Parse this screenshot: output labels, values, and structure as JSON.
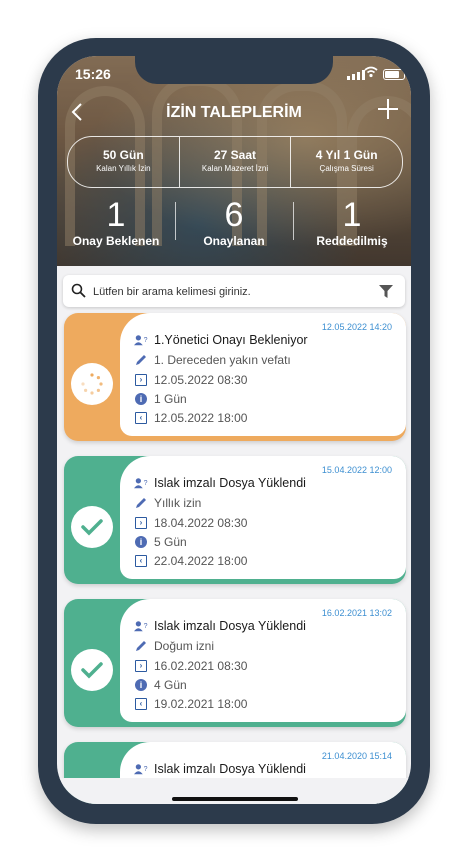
{
  "status_bar": {
    "time": "15:26"
  },
  "header": {
    "title": "İZİN TALEPLERİM"
  },
  "stats": [
    {
      "value": "50 Gün",
      "label": "Kalan Yıllık İzin"
    },
    {
      "value": "27 Saat",
      "label": "Kalan Mazeret İzni"
    },
    {
      "value": "4 Yıl 1 Gün",
      "label": "Çalışma Süresi"
    }
  ],
  "counts": [
    {
      "number": "1",
      "label": "Onay Beklenen"
    },
    {
      "number": "6",
      "label": "Onaylanan"
    },
    {
      "number": "1",
      "label": "Reddedilmiş"
    }
  ],
  "search": {
    "placeholder": "Lütfen bir arama kelimesi giriniz."
  },
  "colors": {
    "pending": "#eeaa5e",
    "approved": "#4fb08f",
    "date": "#3d8fd1"
  },
  "requests": [
    {
      "date": "12.05.2022 14:20",
      "status": "1.Yönetici Onayı Bekleniyor",
      "type": "1. Dereceden yakın vefatı",
      "start": "12.05.2022 08:30",
      "duration": "1 Gün",
      "end": "12.05.2022 18:00",
      "icon": "spinner-icon"
    },
    {
      "date": "15.04.2022 12:00",
      "status": "Islak imzalı Dosya Yüklendi",
      "type": "Yıllık izin",
      "start": "18.04.2022 08:30",
      "duration": "5 Gün",
      "end": "22.04.2022 18:00",
      "icon": "check-icon"
    },
    {
      "date": "16.02.2021 13:02",
      "status": "Islak imzalı Dosya Yüklendi",
      "type": "Doğum izni",
      "start": "16.02.2021 08:30",
      "duration": "4 Gün",
      "end": "19.02.2021 18:00",
      "icon": "check-icon"
    },
    {
      "date": "21.04.2020 15:14",
      "status": "Islak imzalı Dosya Yüklendi"
    }
  ]
}
